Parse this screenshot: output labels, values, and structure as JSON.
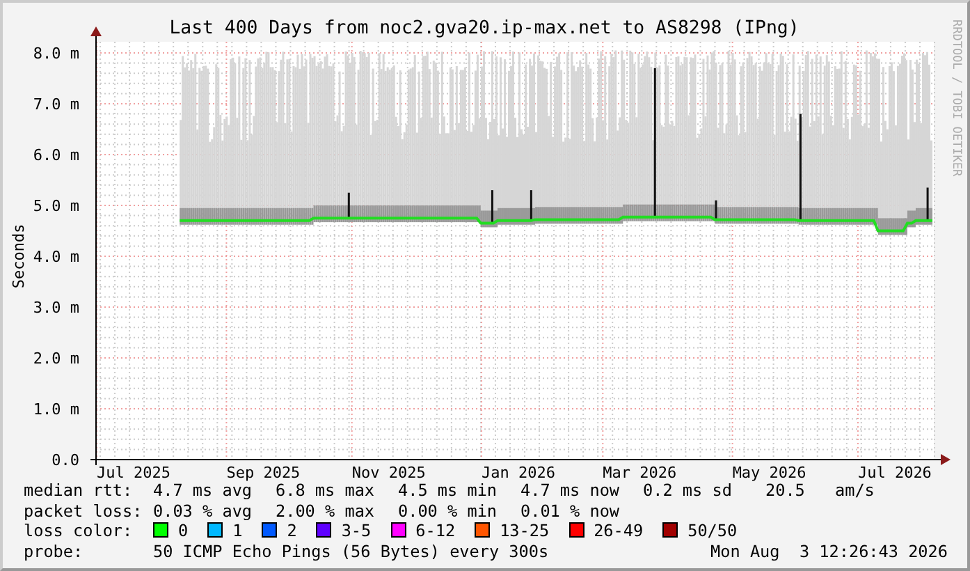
{
  "graph": {
    "credit": "RRDTOOL / TOBI OETIKER",
    "chart_data": {
      "type": "line",
      "title": "Last 400 Days from noc2.gva20.ip-max.net to AS8298 (IPng)",
      "ylabel": "Seconds",
      "ylim": [
        0,
        8.0
      ],
      "yticks": [
        {
          "value": 0,
          "label": "0.0"
        },
        {
          "value": 1,
          "label": "1.0 m"
        },
        {
          "value": 2,
          "label": "2.0 m"
        },
        {
          "value": 3,
          "label": "3.0 m"
        },
        {
          "value": 4,
          "label": "4.0 m"
        },
        {
          "value": 5,
          "label": "5.0 m"
        },
        {
          "value": 6,
          "label": "6.0 m"
        },
        {
          "value": 7,
          "label": "7.0 m"
        },
        {
          "value": 8,
          "label": "8.0 m"
        }
      ],
      "grid": true,
      "categories": [
        null,
        null,
        null,
        null,
        null,
        null,
        null,
        null,
        null,
        "Jul 2025",
        null,
        null,
        null,
        null,
        null,
        null,
        null,
        null,
        null,
        null,
        null,
        null,
        null,
        null,
        null,
        null,
        null,
        null,
        null,
        null,
        null,
        null,
        null,
        null,
        null,
        null,
        null,
        null,
        null,
        null,
        "Sep 2025",
        null,
        null,
        null,
        null,
        null,
        null,
        null,
        null,
        null,
        null,
        null,
        null,
        null,
        null,
        null,
        null,
        null,
        null,
        null,
        null,
        null,
        null,
        null,
        null,
        null,
        null,
        null,
        null,
        null,
        "Nov 2025",
        null,
        null,
        null,
        null,
        null,
        null,
        null,
        null,
        null,
        null,
        null,
        null,
        null,
        null,
        null,
        null,
        null,
        null,
        null,
        null,
        null,
        null,
        null,
        null,
        null,
        null,
        null,
        null,
        null,
        null,
        "Jan 2026",
        null,
        null,
        null,
        null,
        null,
        null,
        null,
        null,
        null,
        null,
        null,
        null,
        null,
        null,
        null,
        null,
        null,
        null,
        null,
        null,
        null,
        null,
        null,
        null,
        null,
        null,
        null,
        null,
        "Mar 2026",
        null,
        null,
        null,
        null,
        null,
        null,
        null,
        null,
        null,
        null,
        null,
        null,
        null,
        null,
        null,
        null,
        null,
        null,
        null,
        null,
        null,
        null,
        null,
        null,
        null,
        null,
        null,
        null,
        null,
        null,
        "May 2026",
        null,
        null,
        null,
        null,
        null,
        null,
        null,
        null,
        null,
        null,
        null,
        null,
        null,
        null,
        null,
        null,
        null,
        null,
        null,
        null,
        null,
        null,
        null,
        null,
        null,
        null,
        null,
        null,
        null,
        "Jul 2026",
        null,
        null,
        null,
        null,
        null,
        null,
        null,
        null,
        null
      ],
      "series": [
        {
          "color": "#22dd22",
          "values": [
            null,
            null,
            null,
            null,
            null,
            null,
            null,
            null,
            null,
            null,
            null,
            null,
            null,
            null,
            null,
            null,
            null,
            null,
            null,
            null,
            4.7,
            4.7,
            4.7,
            4.7,
            4.7,
            4.7,
            4.7,
            4.7,
            4.7,
            4.7,
            4.7,
            4.7,
            4.7,
            4.7,
            4.7,
            4.7,
            4.7,
            4.7,
            4.7,
            4.7,
            4.7,
            4.7,
            4.7,
            4.7,
            4.7,
            4.7,
            4.7,
            4.7,
            4.7,
            4.7,
            4.7,
            4.7,
            4.75,
            4.75,
            4.75,
            4.75,
            4.75,
            4.75,
            4.75,
            4.75,
            4.75,
            4.75,
            4.75,
            4.75,
            4.75,
            4.75,
            4.75,
            4.75,
            4.75,
            4.75,
            4.75,
            4.75,
            4.75,
            4.75,
            4.75,
            4.75,
            4.75,
            4.75,
            4.75,
            4.75,
            4.75,
            4.75,
            4.75,
            4.75,
            4.75,
            4.75,
            4.75,
            4.75,
            4.75,
            4.75,
            4.75,
            4.75,
            4.65,
            4.65,
            4.65,
            4.65,
            4.7,
            4.7,
            4.7,
            4.7,
            4.7,
            4.7,
            4.7,
            4.7,
            4.7,
            4.72,
            4.72,
            4.72,
            4.72,
            4.72,
            4.72,
            4.72,
            4.72,
            4.72,
            4.72,
            4.72,
            4.72,
            4.72,
            4.72,
            4.72,
            4.72,
            4.72,
            4.72,
            4.72,
            4.72,
            4.72,
            4.77,
            4.77,
            4.77,
            4.77,
            4.77,
            4.77,
            4.77,
            4.77,
            4.77,
            4.77,
            4.77,
            4.77,
            4.77,
            4.77,
            4.77,
            4.77,
            4.77,
            4.77,
            4.77,
            4.77,
            4.77,
            4.77,
            4.72,
            4.72,
            4.72,
            4.72,
            4.72,
            4.72,
            4.72,
            4.72,
            4.72,
            4.72,
            4.72,
            4.72,
            4.72,
            4.72,
            4.72,
            4.72,
            4.72,
            4.72,
            4.72,
            4.72,
            4.7,
            4.7,
            4.7,
            4.7,
            4.7,
            4.7,
            4.7,
            4.7,
            4.7,
            4.7,
            4.7,
            4.7,
            4.7,
            4.7,
            4.7,
            4.7,
            4.7,
            4.7,
            4.7,
            4.5,
            4.5,
            4.5,
            4.5,
            4.5,
            4.5,
            4.5,
            4.65,
            4.65,
            4.7,
            4.7,
            4.7,
            4.7,
            4.7
          ]
        }
      ]
    }
  },
  "legend": {
    "stats": [
      {
        "label": "median rtt:",
        "values": [
          "4.7 ms avg",
          "6.8 ms max",
          "4.5 ms min",
          "4.7 ms now",
          "0.2 ms sd",
          "20.5",
          "am/s"
        ]
      },
      {
        "label": "packet loss:",
        "values": [
          "0.03 % avg",
          "2.00 % max",
          "0.00 % min",
          "0.01 % now"
        ]
      }
    ],
    "loss_color": {
      "label": "loss color:",
      "items": [
        {
          "label": "0",
          "color": "#00ff00"
        },
        {
          "label": "1",
          "color": "#00b8ff"
        },
        {
          "label": "2",
          "color": "#0059ff"
        },
        {
          "label": "3-5",
          "color": "#5e00ff"
        },
        {
          "label": "6-12",
          "color": "#ff00ff"
        },
        {
          "label": "13-25",
          "color": "#ff5500"
        },
        {
          "label": "26-49",
          "color": "#ff0000"
        },
        {
          "label": "50/50",
          "color": "#a10000"
        }
      ]
    },
    "probe": {
      "label": "probe:",
      "text": "50 ICMP Echo Pings (56 Bytes) every 300s",
      "timestamp": "Mon Aug  3 12:26:43 2026"
    }
  }
}
